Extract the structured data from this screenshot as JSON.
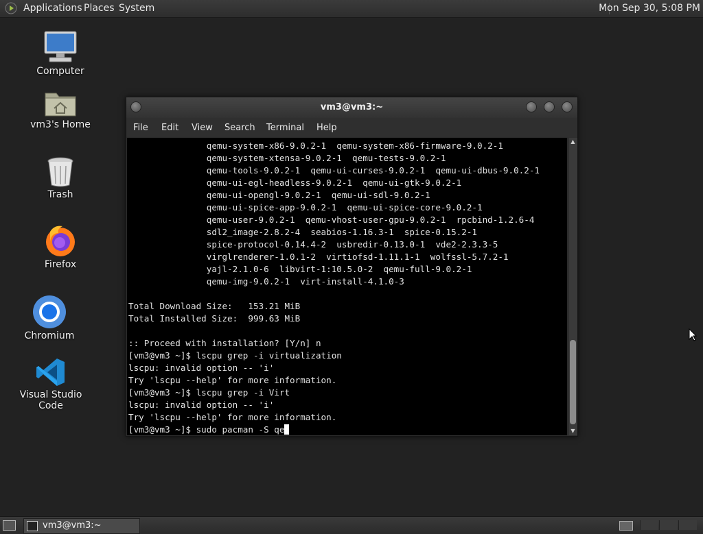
{
  "top_panel": {
    "menus": [
      "Applications",
      "Places",
      "System"
    ],
    "clock": "Mon Sep 30,  5:08 PM"
  },
  "desktop": {
    "icons": [
      {
        "label": "Computer",
        "icon": "computer-icon"
      },
      {
        "label": "vm3's Home",
        "icon": "home-folder-icon"
      },
      {
        "label": "Trash",
        "icon": "trash-icon"
      },
      {
        "label": "Firefox",
        "icon": "firefox-icon"
      },
      {
        "label": "Chromium",
        "icon": "chromium-icon"
      },
      {
        "label": "Visual Studio Code",
        "icon": "vscode-icon"
      }
    ]
  },
  "terminal": {
    "title": "vm3@vm3:~",
    "menu": [
      "File",
      "Edit",
      "View",
      "Search",
      "Terminal",
      "Help"
    ],
    "lines": [
      "               qemu-system-x86-9.0.2-1  qemu-system-x86-firmware-9.0.2-1",
      "               qemu-system-xtensa-9.0.2-1  qemu-tests-9.0.2-1",
      "               qemu-tools-9.0.2-1  qemu-ui-curses-9.0.2-1  qemu-ui-dbus-9.0.2-1",
      "               qemu-ui-egl-headless-9.0.2-1  qemu-ui-gtk-9.0.2-1",
      "               qemu-ui-opengl-9.0.2-1  qemu-ui-sdl-9.0.2-1",
      "               qemu-ui-spice-app-9.0.2-1  qemu-ui-spice-core-9.0.2-1",
      "               qemu-user-9.0.2-1  qemu-vhost-user-gpu-9.0.2-1  rpcbind-1.2.6-4",
      "               sdl2_image-2.8.2-4  seabios-1.16.3-1  spice-0.15.2-1",
      "               spice-protocol-0.14.4-2  usbredir-0.13.0-1  vde2-2.3.3-5",
      "               virglrenderer-1.0.1-2  virtiofsd-1.11.1-1  wolfssl-5.7.2-1",
      "               yajl-2.1.0-6  libvirt-1:10.5.0-2  qemu-full-9.0.2-1",
      "               qemu-img-9.0.2-1  virt-install-4.1.0-3",
      "",
      "Total Download Size:   153.21 MiB",
      "Total Installed Size:  999.63 MiB",
      "",
      ":: Proceed with installation? [Y/n] n",
      "[vm3@vm3 ~]$ lscpu grep -i virtualization",
      "lscpu: invalid option -- 'i'",
      "Try 'lscpu --help' for more information.",
      "[vm3@vm3 ~]$ lscpu grep -i Virt",
      "lscpu: invalid option -- 'i'",
      "Try 'lscpu --help' for more information.",
      "[vm3@vm3 ~]$ sudo pacman -S qe"
    ]
  },
  "taskbar": {
    "window_label": "vm3@vm3:~"
  }
}
